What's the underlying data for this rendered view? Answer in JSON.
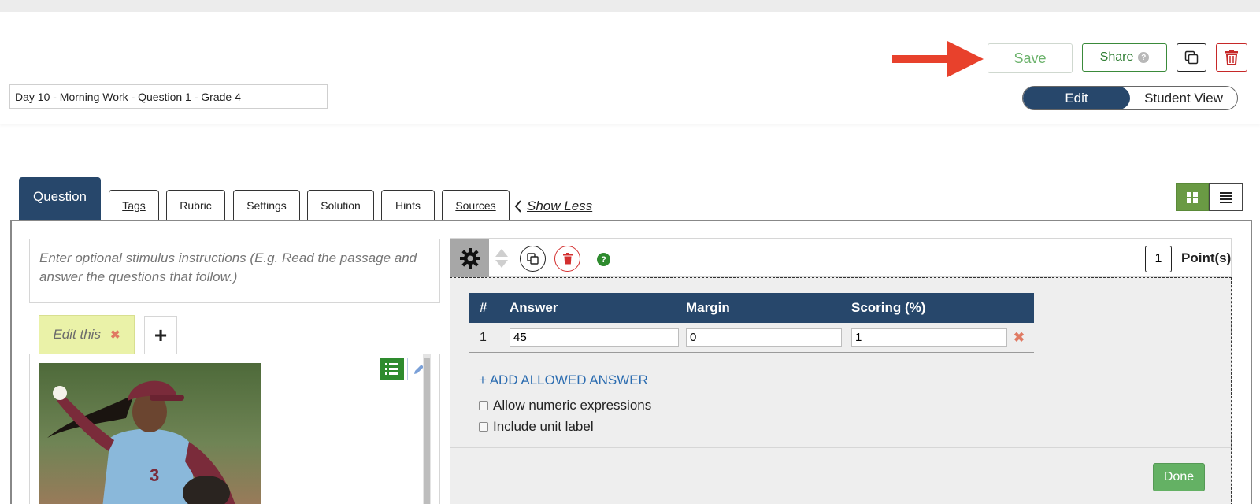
{
  "toolbar": {
    "save_label": "Save",
    "share_label": "Share",
    "share_help": "?",
    "arrow_color": "#e8412c"
  },
  "title": {
    "value": "Day 10 - Morning Work - Question 1 - Grade 4"
  },
  "view_toggle": {
    "edit_label": "Edit",
    "student_label": "Student View",
    "active": "Edit"
  },
  "tabs": {
    "active": "Question",
    "items": [
      "Question",
      "Tags",
      "Rubric",
      "Settings",
      "Solution",
      "Hints",
      "Sources"
    ],
    "show_less": "Show Less"
  },
  "stimulus": {
    "placeholder": "Enter optional stimulus instructions (E.g. Read the passage and answer the questions that follow.)"
  },
  "passage_tabs": {
    "edit_label": "Edit this",
    "add_label": "+"
  },
  "widget": {
    "help": "?",
    "points_value": "1",
    "points_label": "Point(s)",
    "table": {
      "headers": [
        "#",
        "Answer",
        "Margin",
        "Scoring (%)"
      ],
      "rows": [
        {
          "num": "1",
          "answer": "45",
          "margin": "0",
          "scoring": "1"
        }
      ]
    },
    "add_answer": "+ ADD ALLOWED ANSWER",
    "options": [
      {
        "label": "Allow numeric expressions",
        "checked": false
      },
      {
        "label": "Include unit label",
        "checked": false
      }
    ],
    "done_label": "Done"
  },
  "colors": {
    "primary_navy": "#27476b",
    "accent_green": "#64b164",
    "danger_red": "#d32f2f",
    "link_blue": "#2b6cb0"
  }
}
